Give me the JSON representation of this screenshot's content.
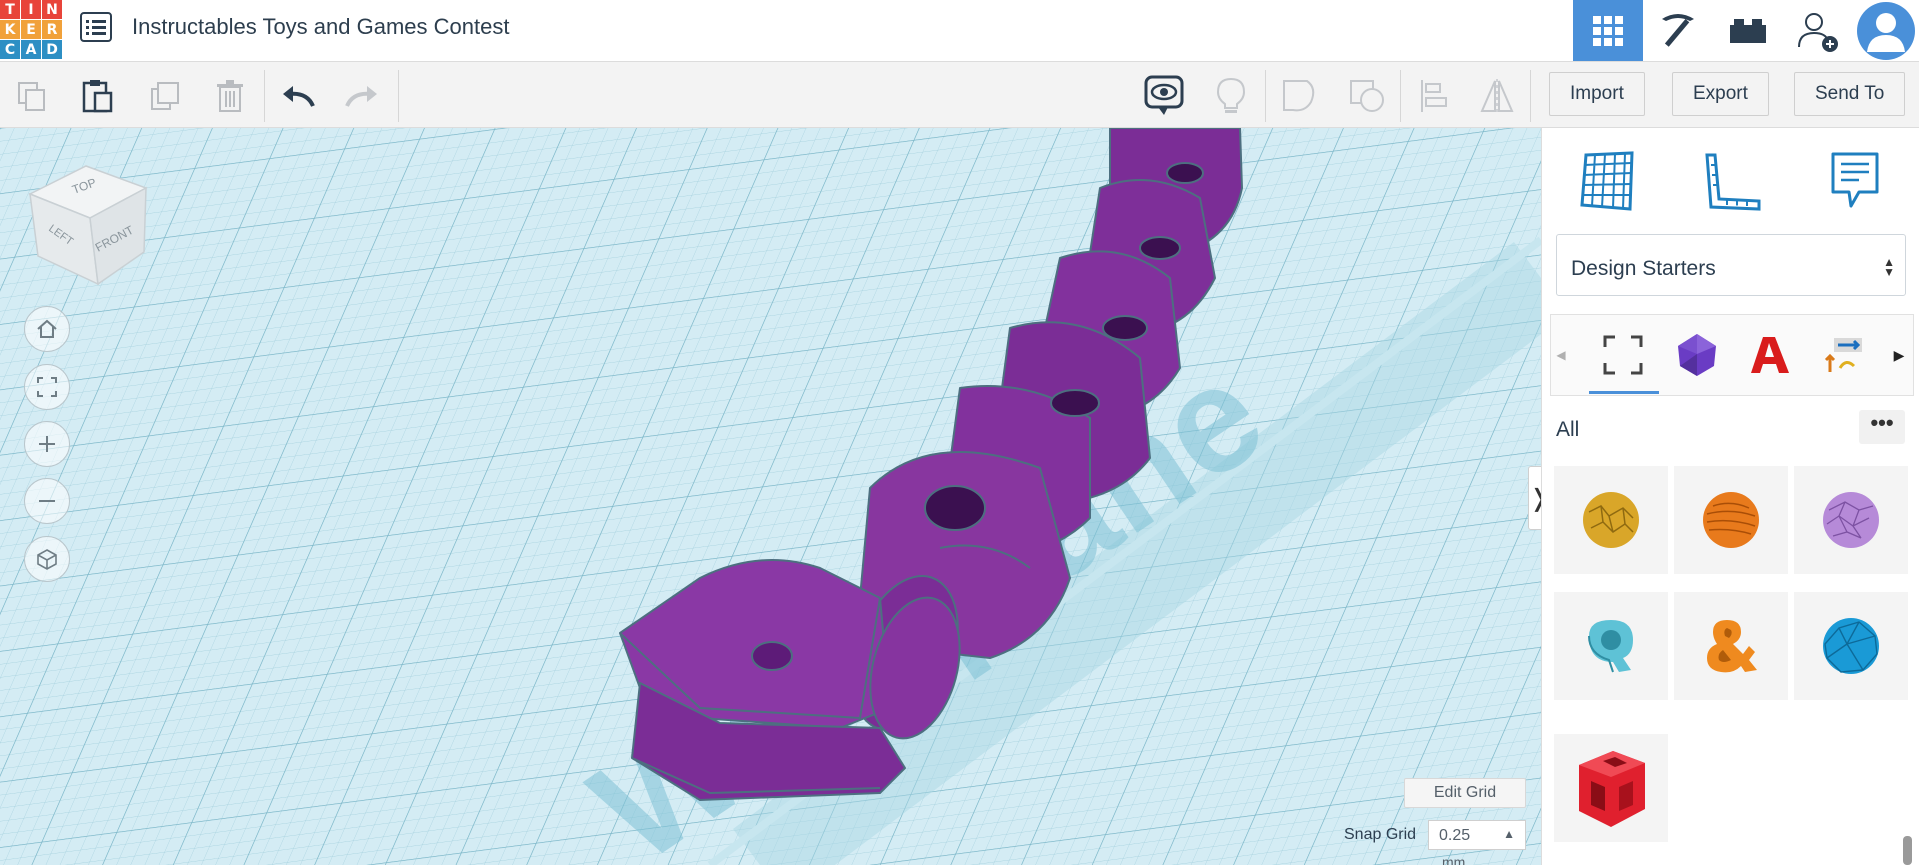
{
  "app": {
    "logo_letters": [
      "T",
      "I",
      "N",
      "K",
      "E",
      "R",
      "C",
      "A",
      "D"
    ],
    "logo_colors": [
      "#e8443a",
      "#e8443a",
      "#e8443a",
      "#f1a13a",
      "#f1a13a",
      "#f1a13a",
      "#2d8fc4",
      "#2d8fc4",
      "#2d8fc4"
    ],
    "title": "Instructables Toys and Games Contest"
  },
  "header": {
    "views": [
      {
        "name": "3d-design-view",
        "icon": "grid-icon",
        "active": true
      },
      {
        "name": "codeblocks-view",
        "icon": "pickaxe-icon",
        "active": false
      },
      {
        "name": "bricks-view",
        "icon": "brick-icon",
        "active": false
      },
      {
        "name": "invite-user",
        "icon": "add-user-icon",
        "active": false
      },
      {
        "name": "account",
        "icon": "avatar-icon",
        "active": false
      }
    ]
  },
  "toolbar": {
    "import_label": "Import",
    "export_label": "Export",
    "send_to_label": "Send To"
  },
  "workplane": {
    "view_cube": {
      "top": "TOP",
      "left": "LEFT",
      "front": "FRONT"
    },
    "watermark": "Workplane",
    "edit_grid_label": "Edit Grid",
    "snap_grid_label": "Snap Grid",
    "snap_grid_value": "0.25",
    "snap_grid_unit": "mm",
    "accent_color": "#7b2d96"
  },
  "panel": {
    "design_starters_label": "Design Starters",
    "all_label": "All",
    "more_label": "•••",
    "shapes": [
      {
        "name": "yellow-textured-sphere",
        "color": "#d9a629"
      },
      {
        "name": "orange-textured-sphere",
        "color": "#e87a1c"
      },
      {
        "name": "purple-textured-sphere",
        "color": "#b68ad8"
      },
      {
        "name": "cyan-letter-q",
        "color": "#5ec2d6"
      },
      {
        "name": "orange-ampersand",
        "color": "#ef8a1f"
      },
      {
        "name": "blue-faceted-sphere",
        "color": "#1a9ad6"
      },
      {
        "name": "red-cube-frame",
        "color": "#e0202e"
      }
    ]
  }
}
